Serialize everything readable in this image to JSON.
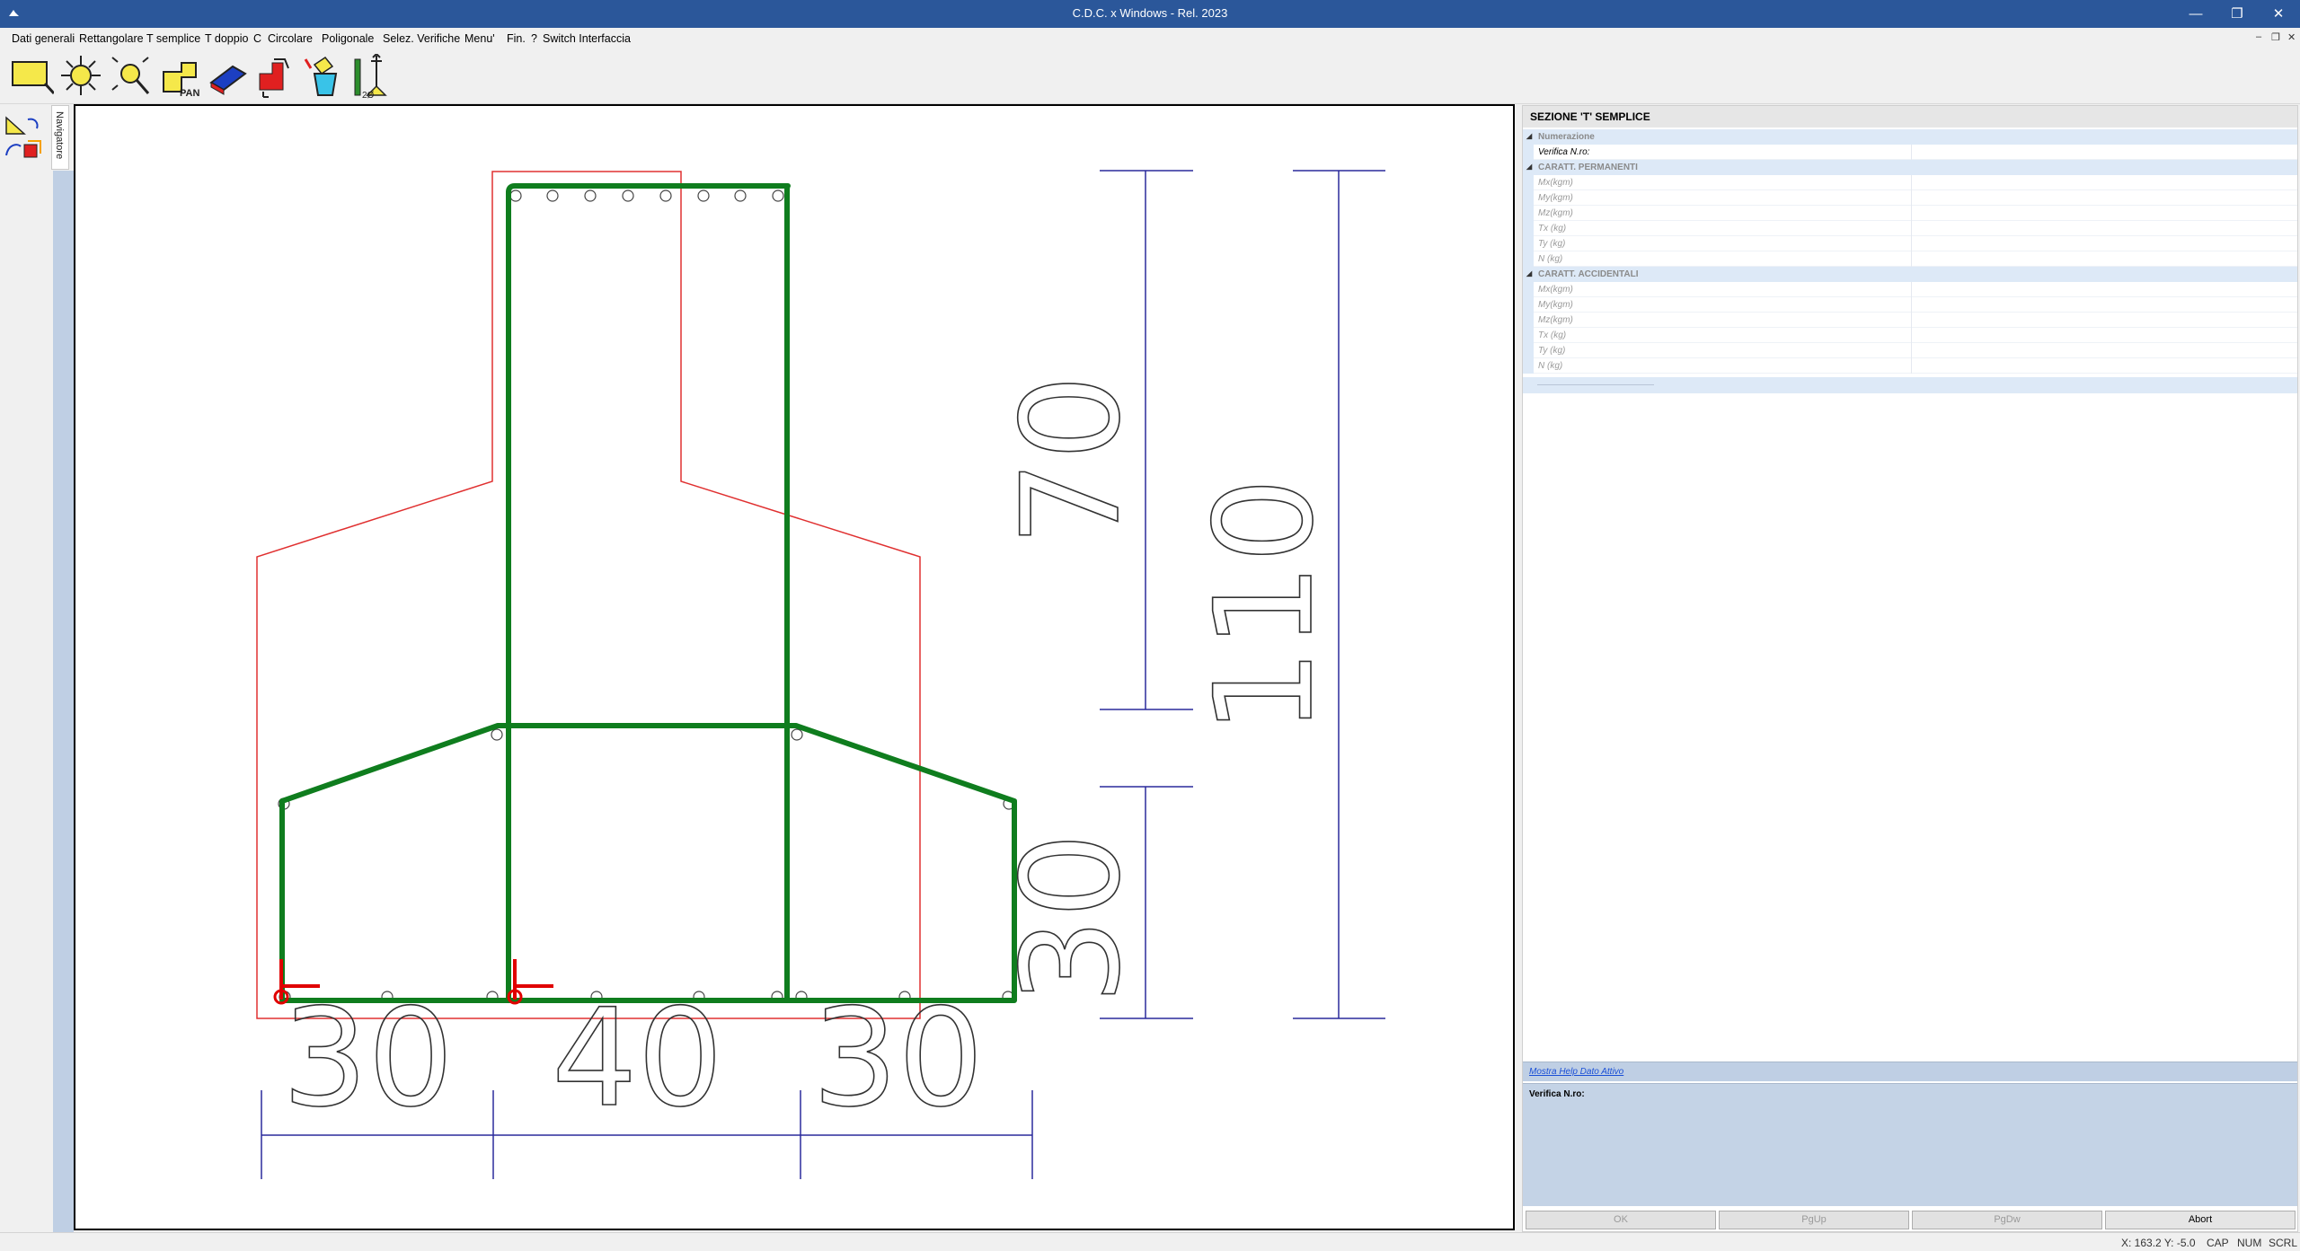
{
  "window": {
    "title": "C.D.C. x Windows - Rel. 2023",
    "minimize": "—",
    "restore": "❐",
    "close": "✕"
  },
  "menu": {
    "items": [
      "Dati generali",
      "Rettangolare",
      "T semplice",
      "T doppio",
      "C",
      "Circolare",
      "Poligonale",
      "Selez. Verifiche",
      "Menu'",
      "Fin.",
      "?",
      "Switch Interfaccia"
    ],
    "mdi_minimize": "–",
    "mdi_restore": "❐",
    "mdi_close": "✕"
  },
  "toolbar": {
    "icons": [
      "zoom-window-icon",
      "zoom-all-icon",
      "zoom-out-icon",
      "pan-icon",
      "eraser-icon",
      "move-origin-icon",
      "fill-bucket-icon",
      "rebar-spacing-icon"
    ],
    "pan_label": "PAN",
    "spacing_label": "2Ø"
  },
  "navigator_tab": "Navigatore",
  "drawing": {
    "dim_bottom": [
      "30",
      "40",
      "30"
    ],
    "dim_right_inner": [
      "70",
      "30"
    ],
    "dim_right_outer": "110",
    "colors": {
      "outline": "#e03030",
      "rebar": "#0f7d1e",
      "dimension": "#2a2a9c",
      "origin": "#e00000"
    }
  },
  "panel": {
    "title": "SEZIONE 'T' SEMPLICE",
    "rows": [
      {
        "kind": "cat",
        "label": "Numerazione"
      },
      {
        "kind": "item",
        "label": "Verifica N.ro:",
        "active": true
      },
      {
        "kind": "cat",
        "label": "CARATT. PERMANENTI"
      },
      {
        "kind": "item",
        "label": "Mx(kgm)"
      },
      {
        "kind": "item",
        "label": "My(kgm)"
      },
      {
        "kind": "item",
        "label": "Mz(kgm)"
      },
      {
        "kind": "item",
        "label": "Tx (kg)"
      },
      {
        "kind": "item",
        "label": "Ty (kg)"
      },
      {
        "kind": "item",
        "label": "N  (kg)"
      },
      {
        "kind": "cat",
        "label": "CARATT. ACCIDENTALI"
      },
      {
        "kind": "item",
        "label": "Mx(kgm)"
      },
      {
        "kind": "item",
        "label": "My(kgm)"
      },
      {
        "kind": "item",
        "label": "Mz(kgm)"
      },
      {
        "kind": "item",
        "label": "Tx (kg)"
      },
      {
        "kind": "item",
        "label": "Ty (kg)"
      },
      {
        "kind": "item",
        "label": "N  (kg)"
      }
    ],
    "help_link": "Mostra Help Dato Attivo",
    "help_text": "Verifica N.ro:",
    "buttons": {
      "ok": "OK",
      "pgup": "PgUp",
      "pgdw": "PgDw",
      "abort": "Abort"
    }
  },
  "status": {
    "coords": "X: 163.2  Y: -5.0",
    "cap": "CAP",
    "num": "NUM",
    "scrl": "SCRL"
  }
}
